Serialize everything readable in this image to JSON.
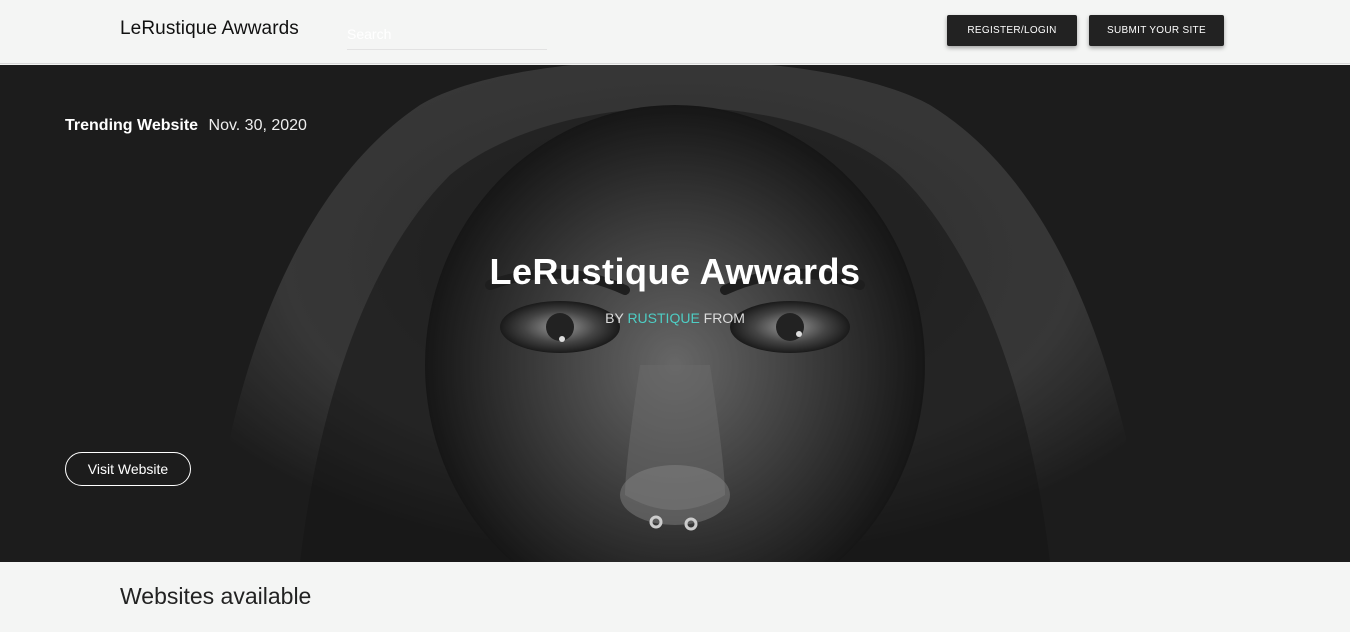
{
  "navbar": {
    "brand": "LeRustique Awwards",
    "search_placeholder": "Search",
    "register_label": "REGISTER/LOGIN",
    "submit_label": "SUBMIT YOUR SITE"
  },
  "hero": {
    "trending_label": "Trending Website",
    "trending_date": "Nov. 30, 2020",
    "title": "LeRustique Awwards",
    "by_prefix": "BY",
    "author": "RUSTIQUE",
    "by_suffix": "FROM",
    "visit_label": "Visit Website",
    "accent_color": "#4ecdc4"
  },
  "main": {
    "section_title": "Websites available"
  }
}
